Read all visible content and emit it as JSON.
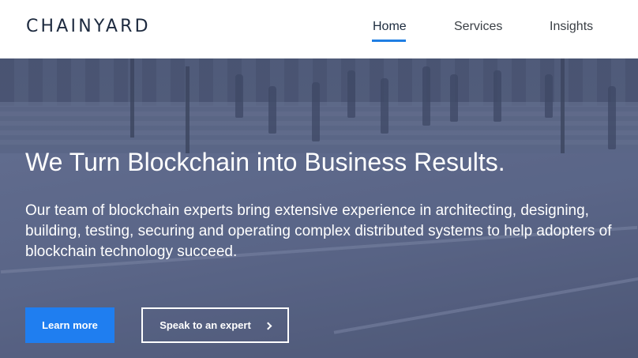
{
  "header": {
    "logo_text": "CHAINYARD",
    "nav": {
      "home": "Home",
      "services": "Services",
      "insights": "Insights"
    },
    "active_nav": "Home",
    "accent_color": "#1f7ee3"
  },
  "hero": {
    "headline": "We Turn Blockchain into Business Results.",
    "description": "Our team of blockchain experts bring extensive experience in architecting, designing, building, testing, securing and operating complex distributed systems to help adopters of blockchain technology succeed.",
    "primary_button": "Learn more",
    "secondary_button": "Speak to an expert",
    "secondary_icon": "chevron-right-icon",
    "primary_button_color": "#1f7ef0"
  }
}
